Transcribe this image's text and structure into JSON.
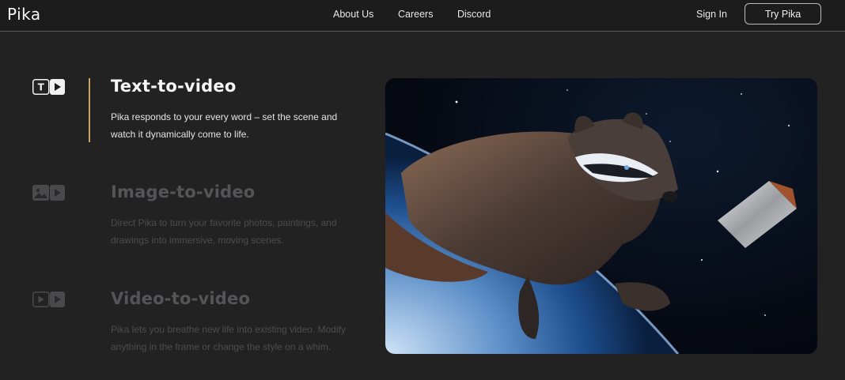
{
  "header": {
    "logo": "Pika",
    "nav": [
      "About Us",
      "Careers",
      "Discord"
    ],
    "sign_in": "Sign In",
    "try_button": "Try Pika"
  },
  "features": [
    {
      "title": "Text-to-video",
      "description": "Pika responds to your every word – set the scene and watch it dynamically come to life.",
      "icon": "text-to-video-icon",
      "active": true
    },
    {
      "title": "Image-to-video",
      "description": "Direct Pika to turn your favorite photos, paintings, and drawings into immersive, moving scenes.",
      "icon": "image-to-video-icon",
      "active": false
    },
    {
      "title": "Video-to-video",
      "description": "Pika lets you breathe new life into existing video. Modify anything in the frame or change the style on a whim.",
      "icon": "video-to-video-icon",
      "active": false
    }
  ],
  "colors": {
    "background": "#222223",
    "accent": "#c9a36a"
  }
}
